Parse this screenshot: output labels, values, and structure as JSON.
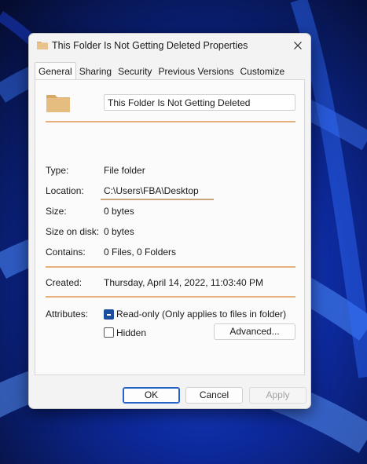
{
  "window": {
    "title": "This Folder Is Not Getting Deleted Properties",
    "title_icon": "folder-icon",
    "close_icon": "close-icon"
  },
  "tabs": [
    {
      "label": "General",
      "active": true
    },
    {
      "label": "Sharing",
      "active": false
    },
    {
      "label": "Security",
      "active": false
    },
    {
      "label": "Previous Versions",
      "active": false
    },
    {
      "label": "Customize",
      "active": false
    }
  ],
  "general": {
    "folder_icon": "folder-icon",
    "name_value": "This Folder Is Not Getting Deleted",
    "type_label": "Type:",
    "type_value": "File folder",
    "location_label": "Location:",
    "location_value": "C:\\Users\\FBA\\Desktop",
    "size_label": "Size:",
    "size_value": "0 bytes",
    "size_on_disk_label": "Size on disk:",
    "size_on_disk_value": "0 bytes",
    "contains_label": "Contains:",
    "contains_value": "0 Files, 0 Folders",
    "created_label": "Created:",
    "created_value": "Thursday, April 14, 2022, 11:03:40 PM",
    "attributes_label": "Attributes:",
    "readonly_label": "Read-only (Only applies to files in folder)",
    "readonly_checked": true,
    "hidden_label": "Hidden",
    "hidden_checked": false,
    "advanced_button": "Advanced..."
  },
  "footer": {
    "ok_label": "OK",
    "cancel_label": "Cancel",
    "apply_label": "Apply"
  },
  "colors": {
    "separator": "#e4b07e",
    "accent": "#1a4fa0",
    "folder": "#dcb67a"
  }
}
